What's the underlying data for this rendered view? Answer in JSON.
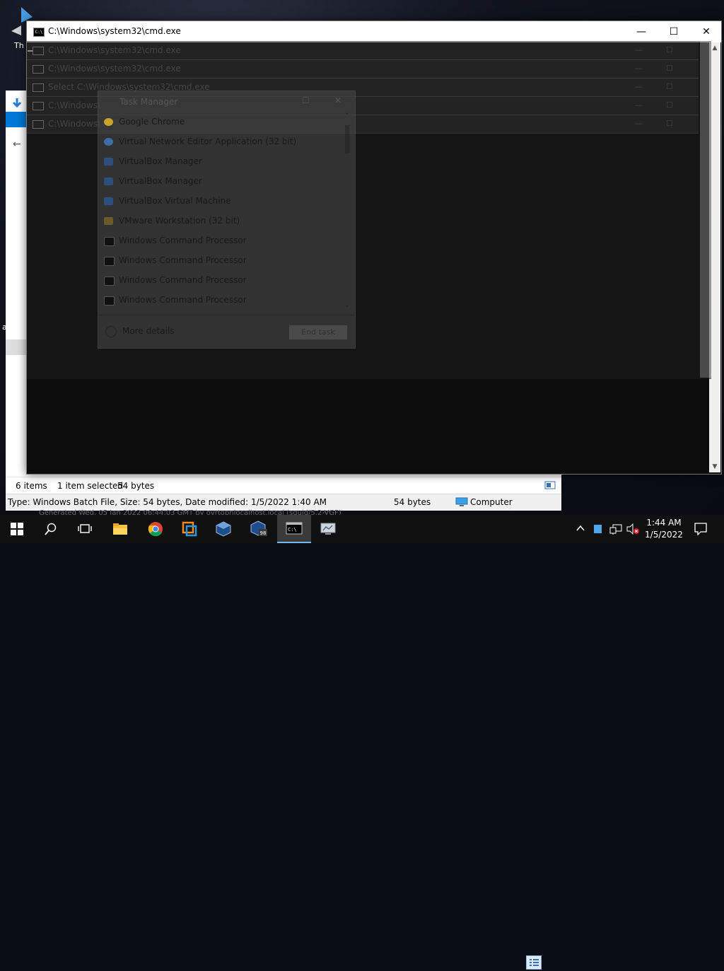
{
  "desktop": {
    "fragment_top": "Th",
    "fragment_left": "a"
  },
  "cmd_window": {
    "title": "C:\\Windows\\system32\\cmd.exe",
    "minimize_glyph": "—",
    "maximize_glyph": "☐",
    "close_glyph": "✕"
  },
  "alt_tab": {
    "rows": [
      {
        "label": "C:\\Windows\\system32\\cmd.exe"
      },
      {
        "label": "C:\\Windows\\system32\\cmd.exe"
      },
      {
        "label": "Select C:\\Windows\\system32\\cmd.exe"
      },
      {
        "label": "C:\\Windows\\"
      },
      {
        "label": "C:\\Windows\\"
      }
    ]
  },
  "task_manager": {
    "title": "Task Manager",
    "items": [
      {
        "label": "Google Chrome",
        "icon": "chrome-icon",
        "color": "#c9a227"
      },
      {
        "label": "Virtual Network Editor Application (32 bit)",
        "icon": "network-icon",
        "color": "#3b6ea8"
      },
      {
        "label": "VirtualBox Manager",
        "icon": "virtualbox-icon",
        "color": "#2c4f7c"
      },
      {
        "label": "VirtualBox Manager",
        "icon": "virtualbox-icon",
        "color": "#2c4f7c"
      },
      {
        "label": "VirtualBox Virtual Machine",
        "icon": "virtualbox-icon",
        "color": "#2c4f7c"
      },
      {
        "label": "VMware Workstation (32 bit)",
        "icon": "vmware-icon",
        "color": "#6b5a2a"
      },
      {
        "label": "Windows Command Processor",
        "icon": "cmd-icon",
        "color": "#111111"
      },
      {
        "label": "Windows Command Processor",
        "icon": "cmd-icon",
        "color": "#111111"
      },
      {
        "label": "Windows Command Processor",
        "icon": "cmd-icon",
        "color": "#111111"
      },
      {
        "label": "Windows Command Processor",
        "icon": "cmd-icon",
        "color": "#111111"
      }
    ],
    "more_details": "More details",
    "end_task": "End task"
  },
  "explorer": {
    "status_items": "6 items",
    "status_selected": "1 item selected",
    "status_size": "54 bytes",
    "detail_type": "Type: Windows Batch File, Size: 54 bytes, Date modified: 1/5/2022 1:40 AM",
    "detail_size": "54 bytes",
    "detail_location": "Computer",
    "footer": "Generated Wed, 05 Jan 2022 06:44:03 GMT by ovrtopnlocalhost.local (squid/5.2-VGF)"
  },
  "taskbar": {
    "time": "1:44 AM",
    "date": "1/5/2022",
    "accent": "#76b9ed"
  }
}
